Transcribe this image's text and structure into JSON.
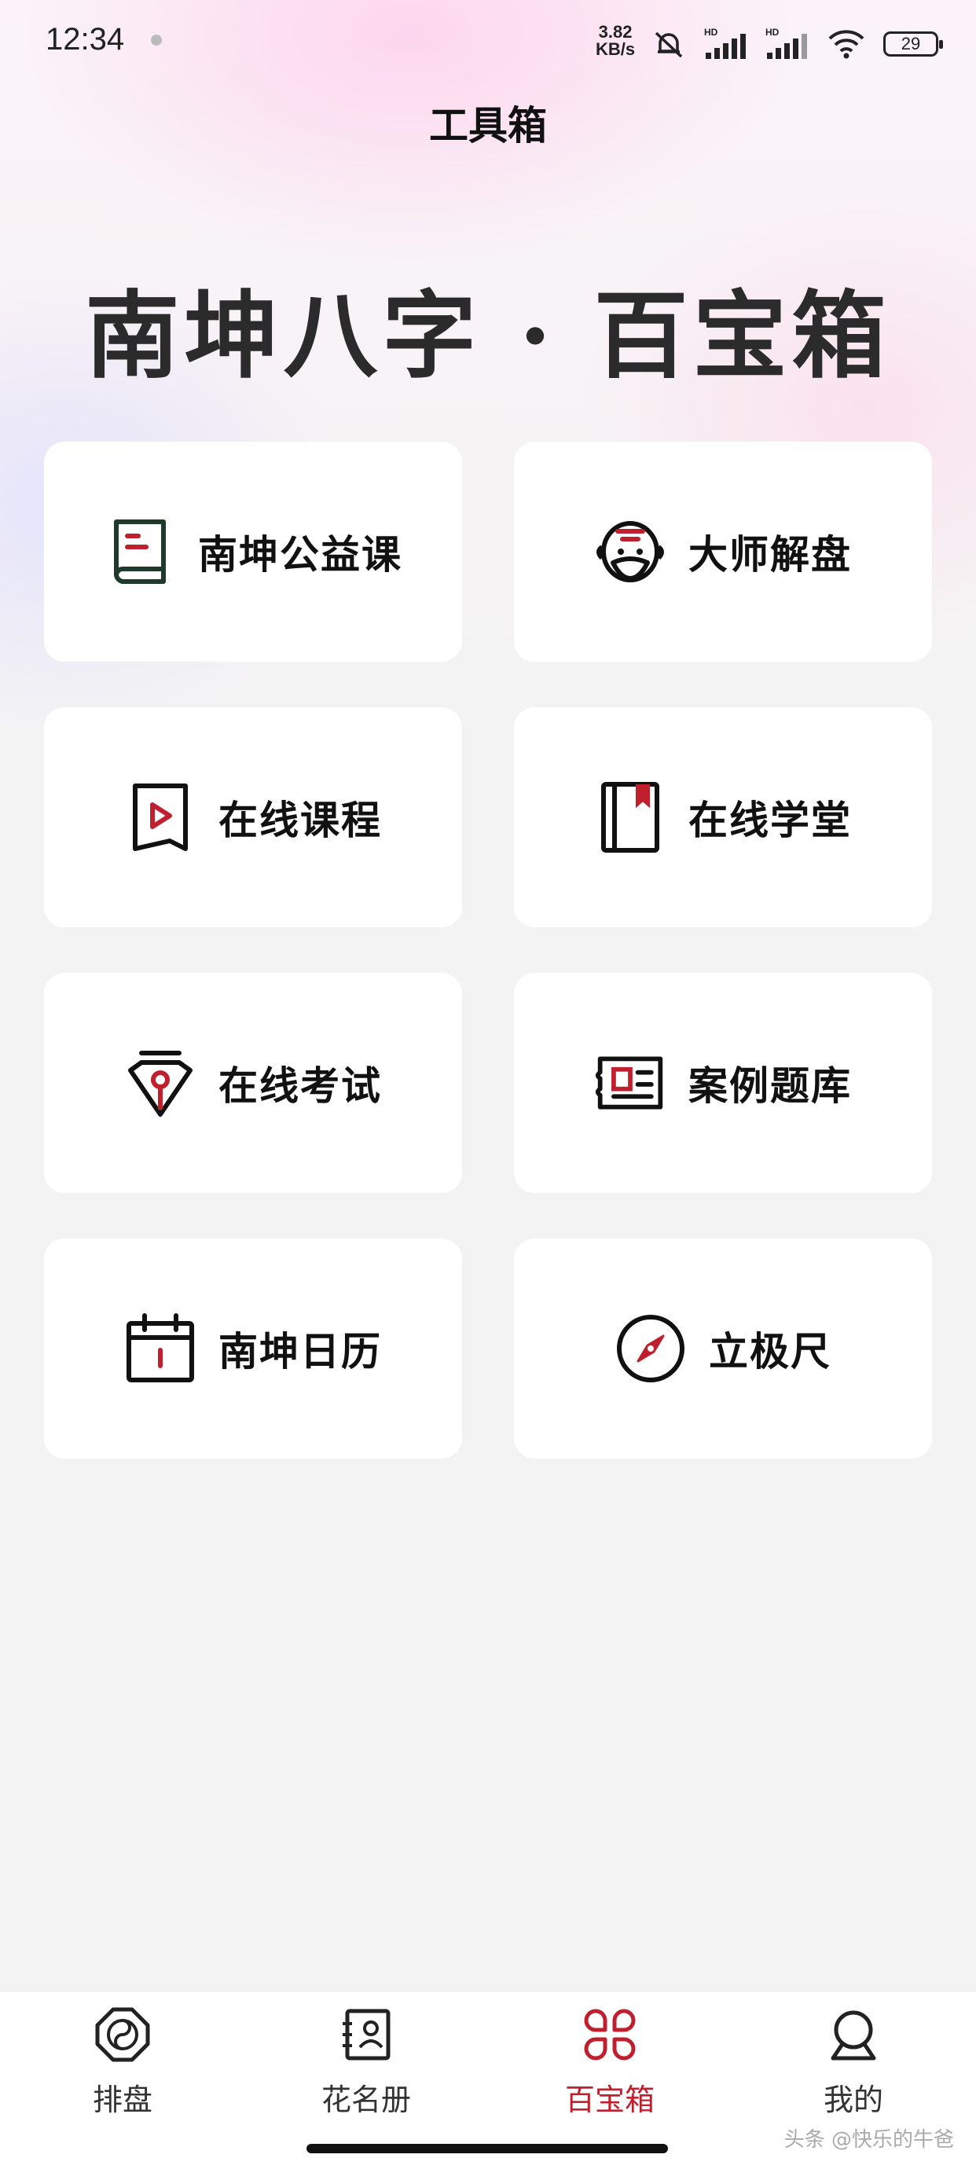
{
  "status_bar": {
    "time": "12:34",
    "net_speed_value": "3.82",
    "net_speed_unit": "KB/s",
    "battery": "29"
  },
  "header": {
    "title": "工具箱"
  },
  "hero": {
    "title": "南坤八字 · 百宝箱"
  },
  "tools": [
    {
      "label": "南坤公益课",
      "icon": "book-icon"
    },
    {
      "label": "大师解盘",
      "icon": "master-face-icon"
    },
    {
      "label": "在线课程",
      "icon": "video-course-icon"
    },
    {
      "label": "在线学堂",
      "icon": "bookmark-book-icon"
    },
    {
      "label": "在线考试",
      "icon": "pen-nib-icon"
    },
    {
      "label": "案例题库",
      "icon": "question-bank-icon"
    },
    {
      "label": "南坤日历",
      "icon": "calendar-icon"
    },
    {
      "label": "立极尺",
      "icon": "compass-icon"
    }
  ],
  "bottom_nav": {
    "items": [
      {
        "label": "排盘",
        "icon": "bagua-icon"
      },
      {
        "label": "花名册",
        "icon": "roster-icon"
      },
      {
        "label": "百宝箱",
        "icon": "treasure-box-icon"
      },
      {
        "label": "我的",
        "icon": "profile-icon"
      }
    ],
    "active_index": 2
  },
  "watermark": "头条 @快乐的牛爸",
  "colors": {
    "accent": "#c0202e",
    "card": "#ffffff",
    "background": "#f3f3f3"
  }
}
